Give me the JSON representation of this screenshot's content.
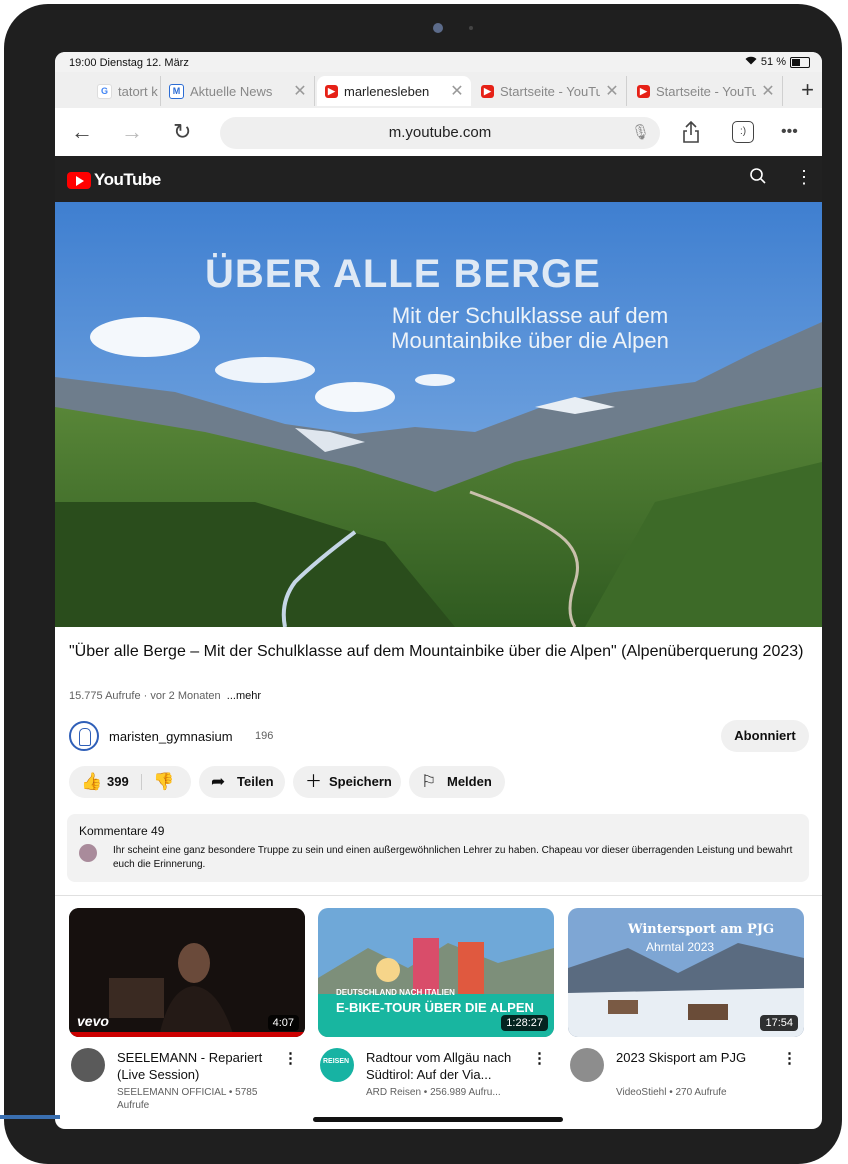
{
  "status_bar": {
    "time_date": "19:00  Dienstag 12. März",
    "battery": "51 %"
  },
  "browser": {
    "tabs": [
      {
        "label": "tatort k",
        "icon": "google-icon",
        "active": false
      },
      {
        "label": "Aktuelle News",
        "icon": "news-icon",
        "active": false
      },
      {
        "label": "marlenesleben",
        "icon": "youtube-icon",
        "active": true
      },
      {
        "label": "Startseite - YouTube",
        "icon": "youtube-icon",
        "active": false
      },
      {
        "label": "Startseite - YouTube",
        "icon": "youtube-icon",
        "active": false
      }
    ],
    "url": "m.youtube.com",
    "tab_count_glyph": ":)"
  },
  "youtube": {
    "logo_text": "YouTube",
    "video": {
      "overlay_title": "ÜBER ALLE BERGE",
      "overlay_subtitle": "Mit der Schulklasse auf dem Mountainbike über die Alpen",
      "title": "\"Über alle Berge – Mit der Schulklasse auf dem Mountainbike über die Alpen\" (Alpenüberquerung 2023)",
      "meta": "15.775 Aufrufe · vor 2 Monaten",
      "more": "...mehr"
    },
    "channel": {
      "name": "maristen_gymnasium",
      "subs": "196",
      "subscribe_label": "Abonniert"
    },
    "actions": {
      "likes": "399",
      "share": "Teilen",
      "save": "Speichern",
      "report": "Melden"
    },
    "comments": {
      "header": "Kommentare 49",
      "top_comment": "Ihr scheint eine ganz besondere Truppe zu sein und einen außergewöhnlichen Lehrer zu haben. Chapeau vor dieser überragenden Leistung und bewahrt euch die Erinnerung."
    },
    "recommendations": [
      {
        "title": "SEELEMANN - Repariert (Live Session)",
        "meta": "SEELEMANN OFFICIAL • 5785 Aufrufe",
        "duration": "4:07",
        "thumb_label": "vevo"
      },
      {
        "title": "Radtour vom Allgäu nach Südtirol: Auf der Via...",
        "meta": "ARD Reisen • 256.989 Aufru...",
        "duration": "1:28:27",
        "thumb_small": "DEUTSCHLAND NACH ITALIEN",
        "thumb_label": "E-BIKE-TOUR ÜBER DIE ALPEN",
        "channel_badge": "REISEN"
      },
      {
        "title": "2023 Skisport am PJG",
        "meta": "VideoStiehl • 270 Aufrufe",
        "duration": "17:54",
        "thumb_title": "Wintersport am PJG",
        "thumb_sub": "Ahrntal 2023"
      }
    ]
  }
}
